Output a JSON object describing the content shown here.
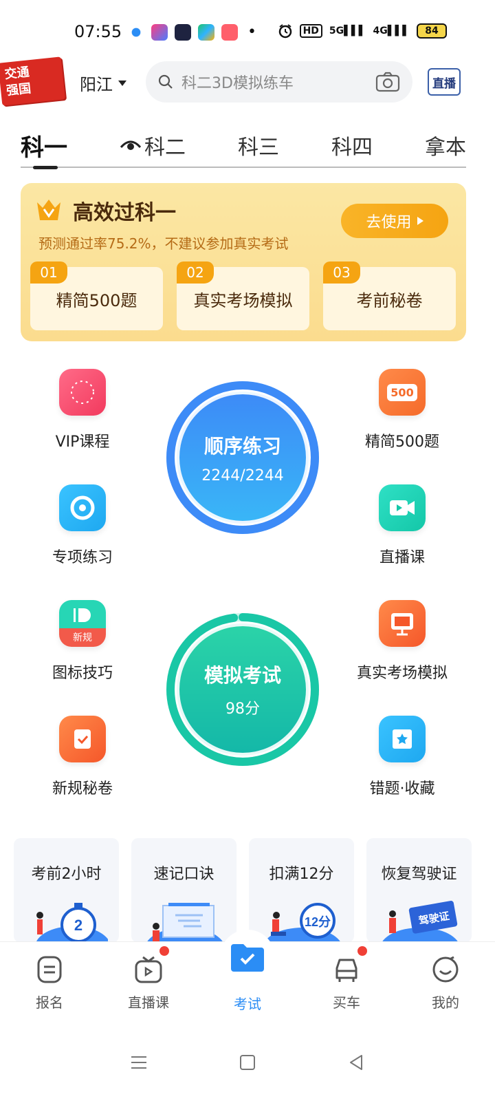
{
  "status": {
    "time": "07:55",
    "hd": "HD",
    "net1": "5G",
    "net2": "4G",
    "battery": "84"
  },
  "header": {
    "promo_line1": "交通",
    "promo_line2": "强国",
    "city": "阳江",
    "search_placeholder": "科二3D模拟练车",
    "live_label": "直播"
  },
  "tabs": [
    {
      "label": "科一"
    },
    {
      "label": "科二"
    },
    {
      "label": "科三"
    },
    {
      "label": "科四"
    },
    {
      "label": "拿本"
    }
  ],
  "promo": {
    "title": "高效过科一",
    "subtitle": "预测通过率75.2%，不建议参加真实考试",
    "button": "去使用",
    "features": [
      {
        "num": "01",
        "label": "精简500题"
      },
      {
        "num": "02",
        "label": "真实考场模拟"
      },
      {
        "num": "03",
        "label": "考前秘卷"
      }
    ]
  },
  "grid": {
    "vip": "VIP课程",
    "special": "专项练习",
    "icon_tips": "图标技巧",
    "new_rules": "新规秘卷",
    "jingjian": "精简500题",
    "live_course": "直播课",
    "real_exam": "真实考场模拟",
    "mistakes": "错题·收藏",
    "new_badge": "新规",
    "badge_500": "500"
  },
  "practice": {
    "title": "顺序练习",
    "progress_text": "2244/2244",
    "progress": 1.0
  },
  "mock": {
    "title": "模拟考试",
    "score": "98分",
    "progress": 0.98
  },
  "cards": [
    {
      "title": "考前2小时",
      "badge": "2"
    },
    {
      "title": "速记口诀",
      "badge": ""
    },
    {
      "title": "扣满12分",
      "badge": "12分"
    },
    {
      "title": "恢复驾驶证",
      "badge": "驾驶证"
    }
  ],
  "bottom_nav": [
    {
      "label": "报名"
    },
    {
      "label": "直播课"
    },
    {
      "label": "考试"
    },
    {
      "label": "买车"
    },
    {
      "label": "我的"
    }
  ],
  "colors": {
    "accent": "#2b8df5",
    "promo_orange": "#f5a412",
    "practice_blue": "#3d8bf7",
    "mock_green": "#19c7a6"
  }
}
